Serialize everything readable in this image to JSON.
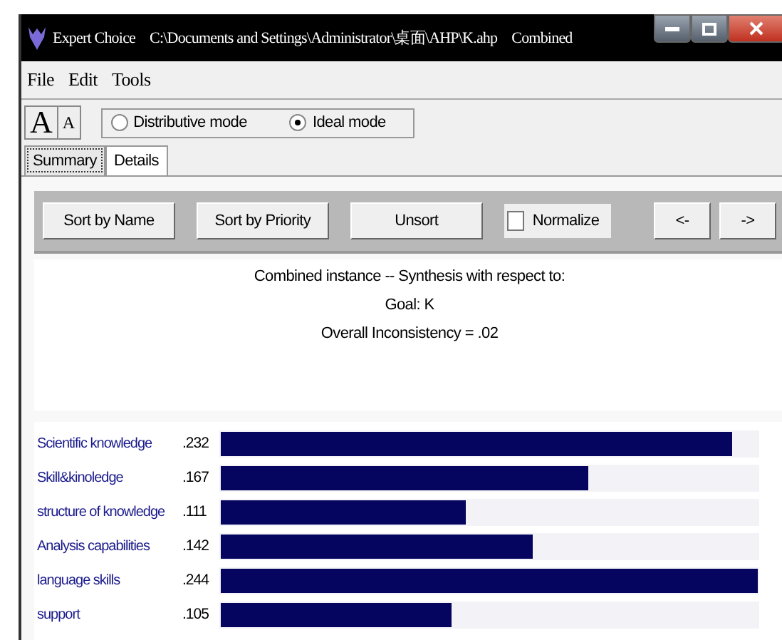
{
  "window": {
    "title": "Expert Choice",
    "path": "C:\\Documents and Settings\\Administrator\\桌面\\AHP\\K.ahp",
    "mode": "Combined"
  },
  "menu": [
    "File",
    "Edit",
    "Tools"
  ],
  "font_buttons": [
    {
      "label": "A",
      "kind": "increase"
    },
    {
      "label": "A",
      "kind": "decrease"
    }
  ],
  "modes": [
    {
      "label": "Distributive mode",
      "selected": false
    },
    {
      "label": "Ideal mode",
      "selected": true
    }
  ],
  "tabs": [
    {
      "label": "Summary",
      "selected": true
    },
    {
      "label": "Details",
      "selected": false
    }
  ],
  "toolbar": [
    {
      "kind": "button",
      "label": "Sort by Name"
    },
    {
      "kind": "button",
      "label": "Sort by Priority"
    },
    {
      "kind": "button",
      "label": "Unsort"
    },
    {
      "kind": "checkbox",
      "label": "Normalize",
      "checked": false
    },
    {
      "kind": "small",
      "label": "<-"
    },
    {
      "kind": "small",
      "label": "->"
    }
  ],
  "synthesis": {
    "heading": "Combined instance -- Synthesis with respect to:",
    "goal": "Goal: K",
    "inconsistency": "Overall Inconsistency = .02"
  },
  "priorities": [
    {
      "name": "Scientific knowledge",
      "value": ".232",
      "level": 0.951
    },
    {
      "name": "Skill&kinoledge",
      "value": ".167",
      "level": 0.684
    },
    {
      "name": "structure of knowledge",
      "value": ".111",
      "level": 0.455
    },
    {
      "name": "Analysis capabilities",
      "value": ".142",
      "level": 0.582
    },
    {
      "name": "language skills",
      "value": ".244",
      "level": 1
    },
    {
      "name": "support",
      "value": ".105",
      "level": 0.43
    }
  ]
}
